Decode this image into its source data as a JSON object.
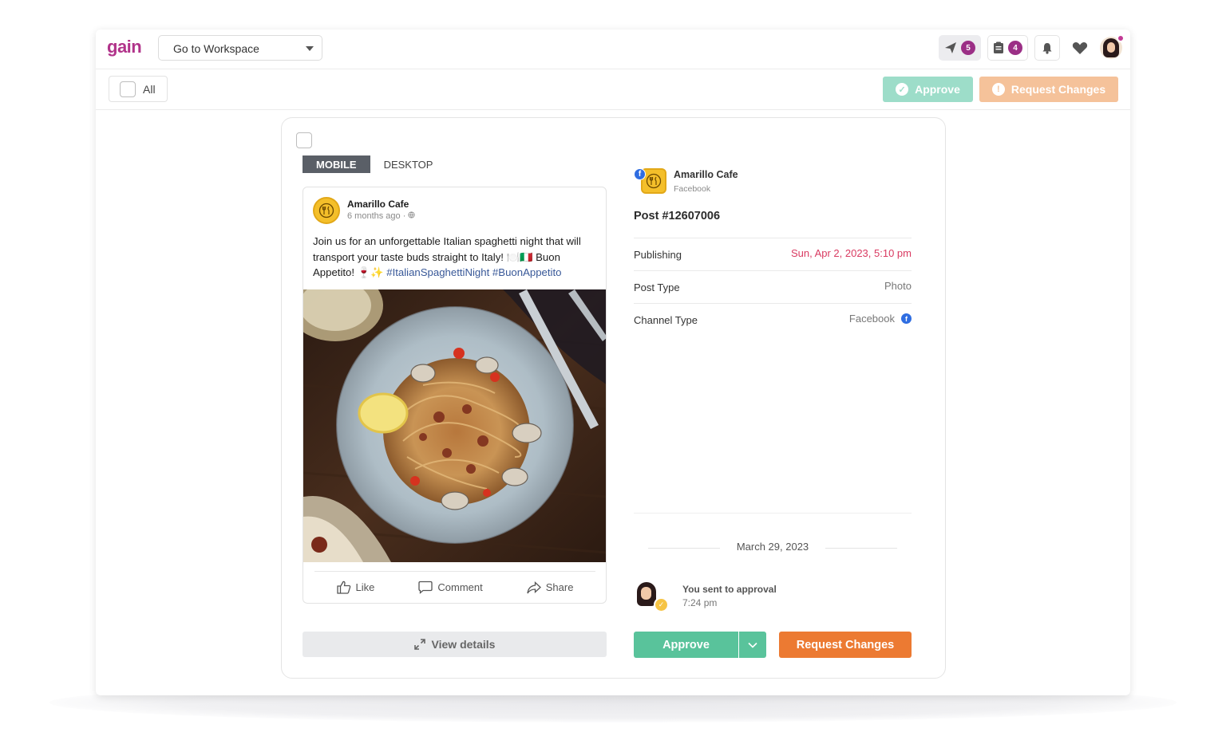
{
  "app": {
    "logo": "gain",
    "workspace_select": "Go to Workspace",
    "outbox_count": "5",
    "tasks_count": "4"
  },
  "actionbar": {
    "all_label": "All",
    "approve_label": "Approve",
    "request_changes_label": "Request Changes"
  },
  "preview": {
    "tabs": [
      {
        "label": "MOBILE",
        "active": true
      },
      {
        "label": "DESKTOP",
        "active": false
      }
    ],
    "page_name": "Amarillo Cafe",
    "post_time": "6 months ago ·",
    "text_main": "Join us for an unforgettable Italian spaghetti night that will transport your taste buds straight to Italy! 🍽️🇮🇹 Buon Appetito! 🍷✨ ",
    "hashtags": "#ItalianSpaghettiNight #BuonAppetito",
    "actions": {
      "like": "Like",
      "comment": "Comment",
      "share": "Share"
    },
    "view_details": "View details"
  },
  "details": {
    "account_name": "Amarillo Cafe",
    "account_network": "Facebook",
    "post_id": "Post #12607006",
    "rows": [
      {
        "key": "Publishing",
        "value": "Sun, Apr 2, 2023, 5:10 pm"
      },
      {
        "key": "Post Type",
        "value": "Photo"
      },
      {
        "key": "Channel Type",
        "value": "Facebook"
      }
    ],
    "activity_date": "March 29, 2023",
    "activity_text": "You sent to approval",
    "activity_time": "7:24 pm",
    "approve_label": "Approve",
    "request_changes_label": "Request Changes"
  },
  "colors": {
    "brand": "#b1338a",
    "approve": "#59c39b",
    "request_changes": "#ec7a32",
    "publishing_date": "#d93a61"
  }
}
